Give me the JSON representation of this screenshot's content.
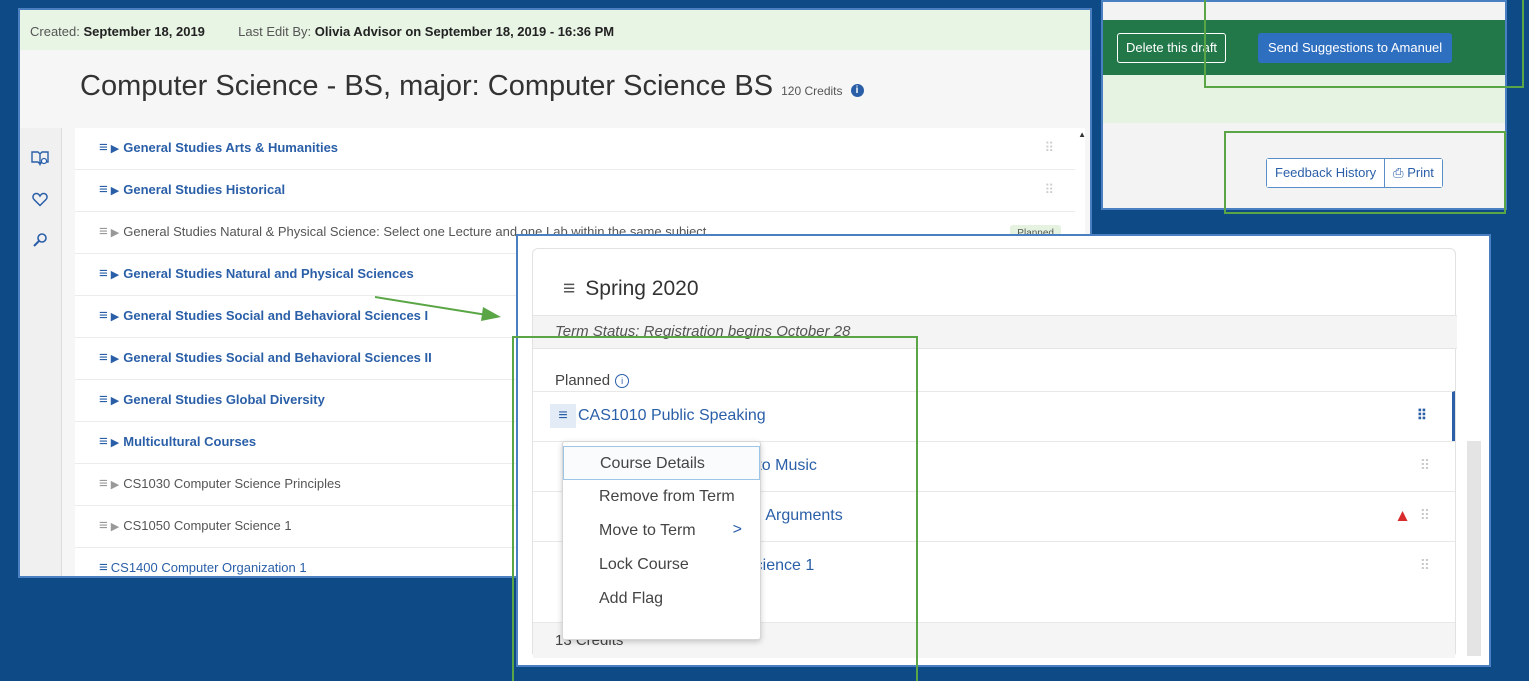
{
  "meta": {
    "created_label": "Created:",
    "created_value": "September 18, 2019",
    "last_edit_label": "Last Edit By:",
    "last_edit_value": "Olivia Advisor on September 18, 2019 - 16:36 PM"
  },
  "plan": {
    "title": "Computer Science - BS, major: Computer Science BS",
    "credits": "120 Credits",
    "info_icon": "i"
  },
  "rail_icons": [
    "degree-map-icon",
    "heart-icon",
    "search-icon"
  ],
  "requirements": [
    {
      "label": "General Studies Arts & Humanities",
      "style": "bold",
      "triangle": true,
      "badge": ""
    },
    {
      "label": "General Studies Historical",
      "style": "bold",
      "triangle": true,
      "badge": ""
    },
    {
      "label": "General Studies Natural & Physical Science: Select one Lecture and one Lab within the same subject.",
      "style": "plain",
      "triangle": true,
      "badge": "Planned"
    },
    {
      "label": "General Studies Natural and Physical Sciences",
      "style": "bold",
      "triangle": true,
      "badge": ""
    },
    {
      "label": "General Studies Social and Behavioral Sciences I",
      "style": "bold",
      "triangle": true,
      "badge": ""
    },
    {
      "label": "General Studies Social and Behavioral Sciences II",
      "style": "bold",
      "triangle": true,
      "badge": ""
    },
    {
      "label": "General Studies Global Diversity",
      "style": "bold",
      "triangle": true,
      "badge": ""
    },
    {
      "label": "Multicultural Courses",
      "style": "bold",
      "triangle": true,
      "badge": ""
    },
    {
      "label": "CS1030 Computer Science Principles",
      "style": "plain",
      "triangle": true,
      "badge": ""
    },
    {
      "label": "CS1050 Computer Science 1",
      "style": "plain",
      "triangle": true,
      "badge": ""
    },
    {
      "label": "CS1400 Computer Organization 1",
      "style": "link",
      "triangle": false,
      "badge": ""
    }
  ],
  "actions": {
    "delete_draft": "Delete this draft",
    "send_suggestions": "Send Suggestions to Amanuel",
    "feedback_history": "Feedback History",
    "print": "Print",
    "print_icon": "printer-icon"
  },
  "term": {
    "name": "Spring 2020",
    "status": "Term Status: Registration begins October 28",
    "planned_label": "Planned",
    "courses": [
      {
        "label": "CAS1010 Public Speaking",
        "warning": false
      },
      {
        "label": "n to Music",
        "warning": false
      },
      {
        "label": "ng Arguments",
        "warning": true
      },
      {
        "label": "Science 1",
        "warning": false
      }
    ],
    "credits": "13 Credits"
  },
  "context_menu": [
    "Course Details",
    "Remove from Term",
    "Move to Term",
    "Lock Course",
    "Add Flag"
  ],
  "colors": {
    "background": "#0d4a86",
    "accent": "#2a5fa8",
    "action_bar": "#23784a",
    "highlight_frame": "#5aa646",
    "warning": "#d92b2b"
  }
}
